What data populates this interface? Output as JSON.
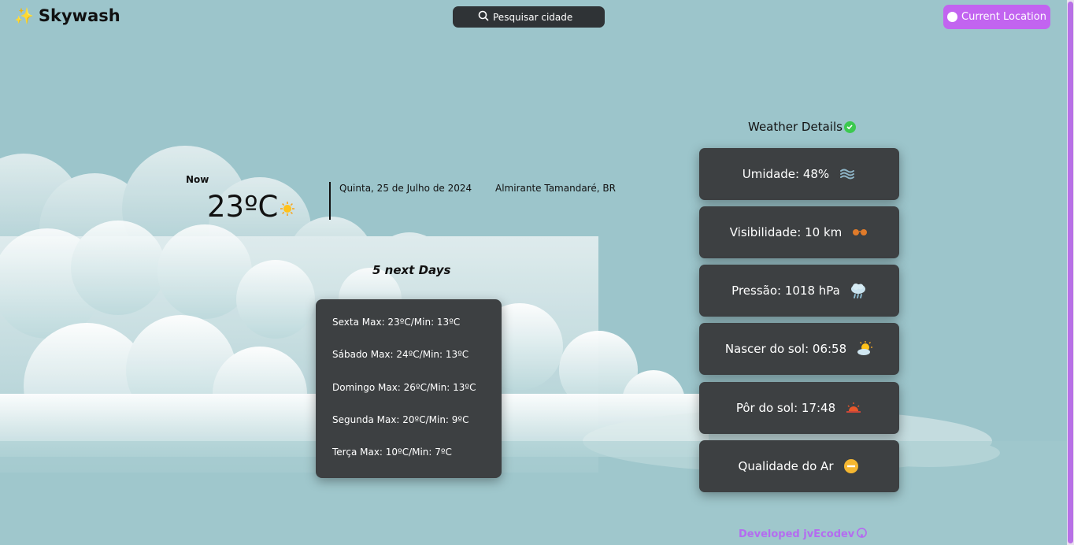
{
  "header": {
    "app_name": "Skywash",
    "search_placeholder": "Pesquisar cidade",
    "location_button": "Current Location"
  },
  "current": {
    "now_label": "Now",
    "temperature": "23ºC",
    "date": "Quinta, 25 de Julho de 2024",
    "city": "Almirante Tamandaré, BR"
  },
  "forecast": {
    "title": "5 next Days",
    "days": [
      "Sexta Max: 23ºC/Min: 13ºC",
      "Sábado Max: 24ºC/Min: 13ºC",
      "Domingo Max: 26ºC/Min: 13ºC",
      "Segunda Max: 20ºC/Min: 9ºC",
      "Terça Max: 10ºC/Min: 7ºC"
    ]
  },
  "details": {
    "title": "Weather Details",
    "items": [
      {
        "label": "Umidade: 48%",
        "icon": "humidity-icon"
      },
      {
        "label": "Visibilidade: 10 km",
        "icon": "glasses-icon"
      },
      {
        "label": "Pressão: 1018 hPa",
        "icon": "storm-cloud-icon"
      },
      {
        "label": "Nascer do sol: 06:58",
        "icon": "sunrise-icon"
      },
      {
        "label": "Pôr do sol: 17:48",
        "icon": "sunset-icon"
      },
      {
        "label": "Qualidade do Ar",
        "icon": "air-quality-icon"
      }
    ]
  },
  "footer": {
    "text": "Developed jvEcodev"
  },
  "colors": {
    "background": "#9cc5cb",
    "card": "#3d4042",
    "accent": "#c264f0",
    "footer": "#b46cf0"
  }
}
